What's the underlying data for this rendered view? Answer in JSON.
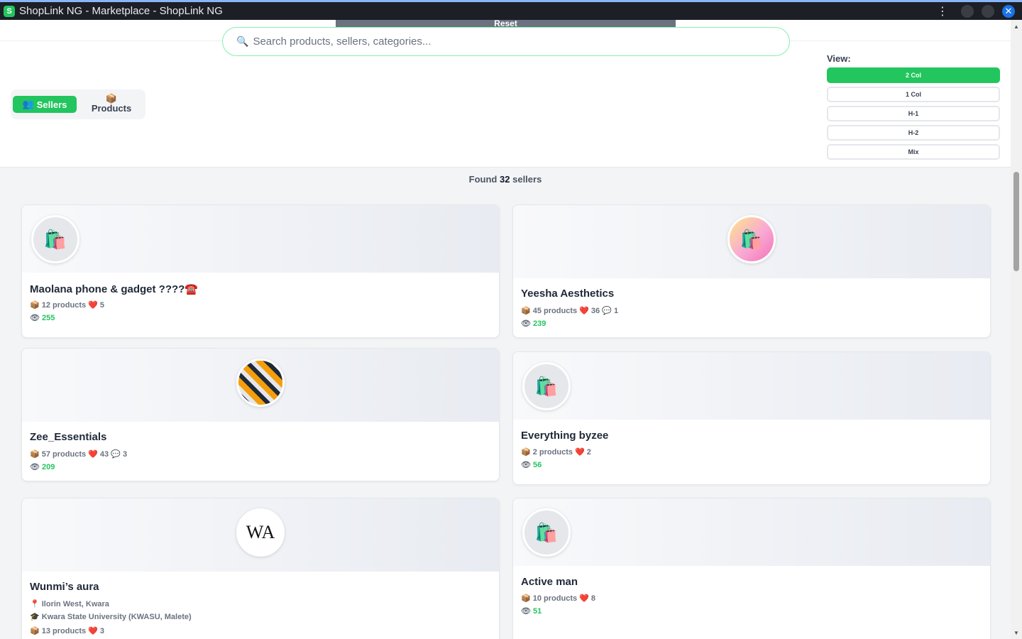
{
  "window": {
    "title": "ShopLink NG - Marketplace - ShopLink NG",
    "icon": "shoplink-logo-icon"
  },
  "header": {
    "reset_label": "Reset",
    "search_placeholder": "Search products, sellers, categories...",
    "toggle": {
      "sellers_label": "Sellers",
      "products_label": "Products"
    },
    "view": {
      "label": "View:",
      "options": [
        "2 Col",
        "1 Col",
        "H-1",
        "H-2",
        "Mix"
      ],
      "selected": "2 Col"
    }
  },
  "results": {
    "prefix": "Found",
    "count": "32",
    "suffix": "sellers"
  },
  "accent_color": "#22c55e",
  "sellers": [
    {
      "name": "Maolana phone & gadget ????☎️",
      "stats": "📦 12 products ❤️ 5",
      "views": "255",
      "avatar": "shopping-bags-icon"
    },
    {
      "name": "Yeesha Aesthetics",
      "stats": "📦 45 products ❤️ 36 💬 1",
      "views": "239",
      "avatar": "yeesha-logo"
    },
    {
      "name": "Zee_Essentials",
      "stats": "📦 57 products ❤️ 43 💬 3",
      "views": "209",
      "avatar": "product-photo"
    },
    {
      "name": "Everything byzee",
      "stats": "📦 2 products ❤️ 2",
      "views": "56",
      "avatar": "shopping-bags-icon"
    },
    {
      "name": "Wunmi’s aura",
      "location": "📍 Ilorin West, Kwara",
      "school": "🎓 Kwara State University (KWASU, Malete)",
      "stats": "📦 13 products ❤️ 3",
      "avatar": "wa-logo",
      "avatar_text": "WA"
    },
    {
      "name": "Active man",
      "stats": "📦 10 products ❤️ 8",
      "views": "51",
      "avatar": "shopping-bags-icon"
    }
  ]
}
